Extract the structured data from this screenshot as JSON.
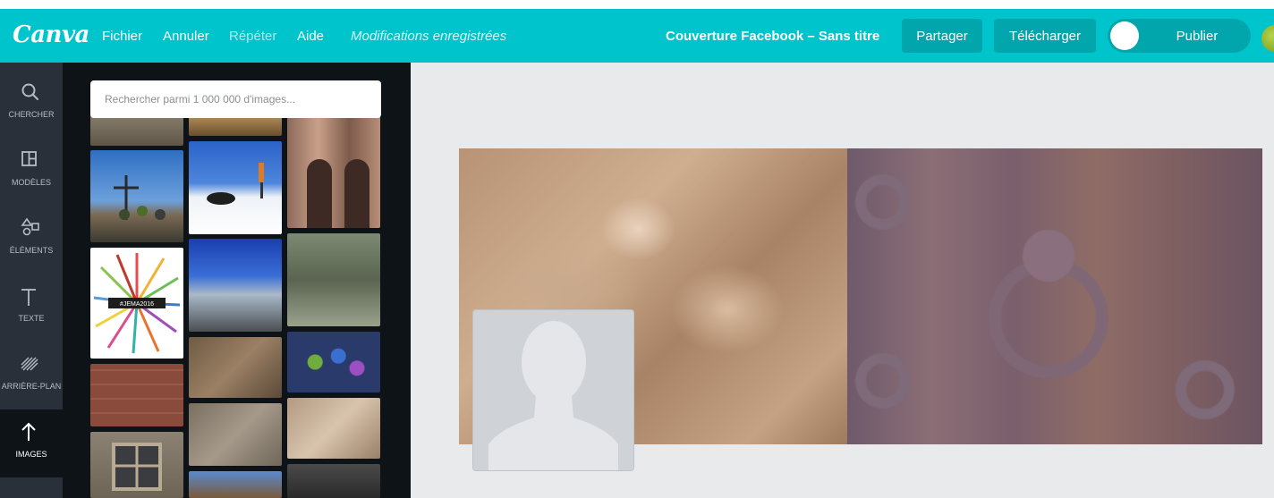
{
  "app": {
    "logo": "Canva",
    "menu": {
      "file": "Fichier",
      "undo": "Annuler",
      "redo": "Répéter",
      "help": "Aide",
      "status": "Modifications enregistrées"
    },
    "document_title": "Couverture Facebook – Sans titre",
    "buttons": {
      "share": "Partager",
      "download": "Télécharger",
      "publish": "Publier"
    }
  },
  "sidebar": {
    "items": [
      {
        "label": "CHERCHER",
        "icon": "search-icon",
        "active": false
      },
      {
        "label": "MODÈLES",
        "icon": "layout-icon",
        "active": false
      },
      {
        "label": "ÉLÉMENTS",
        "icon": "shapes-icon",
        "active": false
      },
      {
        "label": "TEXTE",
        "icon": "text-icon",
        "active": false
      },
      {
        "label": "ARRIÈRE-PLAN",
        "icon": "background-icon",
        "active": false
      },
      {
        "label": "IMAGES",
        "icon": "upload-arrow-icon",
        "active": true
      }
    ]
  },
  "images_panel": {
    "search_placeholder": "Rechercher parmi 1 000 000 d'images...",
    "thumbnail_labels": [
      "#JEMA2016"
    ]
  },
  "colors": {
    "topbar": "#00c4cc",
    "topbar_button": "#01a5ac",
    "rail": "#293039",
    "panel": "#0e1318",
    "workspace": "#e8eaec"
  }
}
